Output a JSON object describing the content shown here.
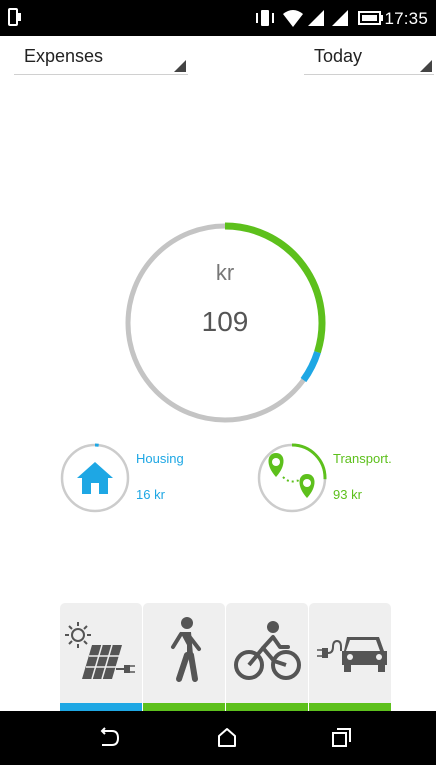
{
  "status": {
    "time": "17:35"
  },
  "filters": {
    "category": "Expenses",
    "period": "Today"
  },
  "total": {
    "unit": "kr",
    "value": "109"
  },
  "categories": [
    {
      "name": "Housing",
      "amount": "16 kr",
      "color": "#1ea7e4",
      "icon": "house-icon"
    },
    {
      "name": "Transport.",
      "amount": "93 kr",
      "color": "#5dc01c",
      "icon": "route-pins-icon"
    }
  ],
  "ring": {
    "housing_kr": 16,
    "transport_kr": 93,
    "total_kr": 109,
    "track_color": "#c4c4c4"
  },
  "options": [
    {
      "icon": "solar-panel-plug-icon",
      "status_color": "#1ea7e4"
    },
    {
      "icon": "walking-person-icon",
      "status_color": "#5dc01c"
    },
    {
      "icon": "cyclist-icon",
      "status_color": "#5dc01c"
    },
    {
      "icon": "electric-car-icon",
      "status_color": "#5dc01c"
    }
  ]
}
